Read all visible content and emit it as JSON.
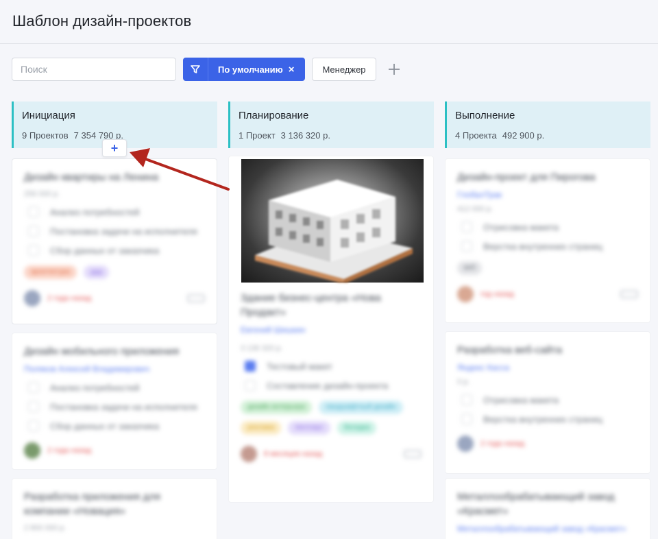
{
  "page": {
    "title": "Шаблон дизайн-проектов"
  },
  "toolbar": {
    "search_placeholder": "Поиск",
    "filter_chip_label": "По умолчанию",
    "filter_chip_close": "×",
    "manager_label": "Менеджер",
    "add_filter_icon": "plus-icon",
    "filter_icon": "funnel-icon"
  },
  "colors": {
    "accent": "#3b63e7",
    "column_bar": "#2cc0c4",
    "column_bg": "#dff0f6",
    "annotation_arrow": "#b3261e"
  },
  "columns": [
    {
      "name": "Инициация",
      "count": "9 Проектов",
      "sum": "7 354 790 р."
    },
    {
      "name": "Планирование",
      "count": "1 Проект",
      "sum": "3 136 320 р."
    },
    {
      "name": "Выполнение",
      "count": "4 Проекта",
      "sum": "492 900 р."
    }
  ],
  "add_card_label": "+",
  "cards": {
    "c1": {
      "title": "Дизайн квартиры на Ленина",
      "amount": "256 000 р.",
      "tasks": [
        "Анализ потребностей",
        "Постановка задачи на исполнителя",
        "Сбор данных от заказчика"
      ],
      "tags": [
        "архитектура",
        "ддд"
      ],
      "date": "2 года назад"
    },
    "c2": {
      "title": "Дизайн мобильного приложения",
      "manager": "Поляков Алексей Владимирович",
      "tasks": [
        "Анализ потребностей",
        "Постановка задачи на исполнителя",
        "Сбор данных от заказчика"
      ],
      "date": "2 года назад"
    },
    "c3": {
      "title": "Разработка приложения для компании «Новация»",
      "amount": "2 800 000 р."
    },
    "c4": {
      "title": "Здание бизнес-центра «Нова Продакт»",
      "manager": "Евгений Шишкин",
      "amount": "3 136 320 р.",
      "tasks": [
        "Тестовый макет",
        "Составление дизайн-проекта"
      ],
      "tags": [
        "дизайн интерьера",
        "ландшафтный дизайн",
        "реклама",
        "пентхаус",
        "беседка"
      ],
      "date": "8 месяцев назад"
    },
    "c5": {
      "title": "Дизайн-проект для Пирогова",
      "manager": "ГлобалТрак",
      "amount": "412 000 р.",
      "tasks": [
        "Отрисовка макета",
        "Верстка внутренних страниц"
      ],
      "tags": [
        "веб"
      ],
      "date": "год назад"
    },
    "c6": {
      "title": "Разработка веб-сайта",
      "manager": "Яндекс Касса",
      "amount": "0 р.",
      "tasks": [
        "Отрисовка макета",
        "Верстка внутренних страниц"
      ],
      "date": "2 года назад"
    },
    "c7": {
      "title": "Металлообрабатывающий завод «Красмет»",
      "manager": "Металлообрабатывающий завод «Красмет»"
    }
  }
}
